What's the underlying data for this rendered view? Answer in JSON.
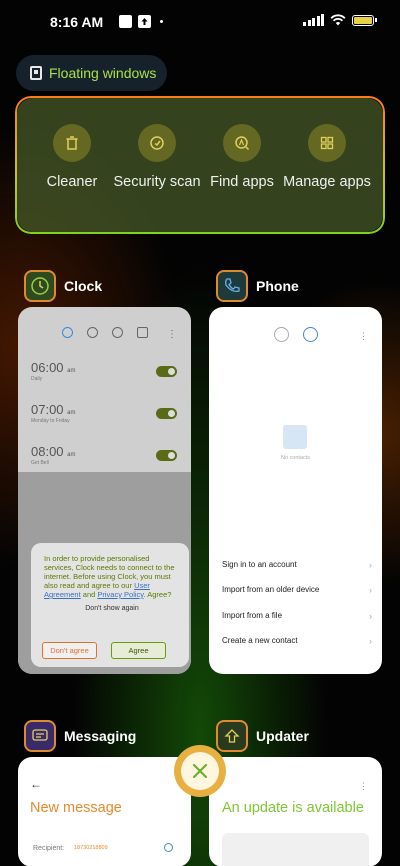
{
  "status_bar": {
    "time": "8:16 AM"
  },
  "floating_windows": {
    "label": "Floating windows"
  },
  "tools": [
    {
      "label": "Cleaner",
      "icon": "trash-icon"
    },
    {
      "label": "Security scan",
      "icon": "shield-check-icon"
    },
    {
      "label": "Find apps",
      "icon": "search-app-icon"
    },
    {
      "label": "Manage apps",
      "icon": "grid-icon"
    }
  ],
  "apps": {
    "clock": {
      "title": "Clock",
      "alarms": [
        {
          "time": "06:00",
          "ampm": "am",
          "sub": "Daily"
        },
        {
          "time": "07:00",
          "ampm": "am",
          "sub": "Monday to Friday"
        },
        {
          "time": "08:00",
          "ampm": "am",
          "sub": "Get Bell"
        }
      ],
      "dialog": {
        "text_1": "In order to provide personalised services, Clock needs to connect to the internet. Before using Clock, you must also read and agree to our ",
        "link_1": "User Agreement",
        "text_2": " and ",
        "link_2": "Privacy Policy",
        "text_3": ". Agree?",
        "secondary": "Don't show again",
        "disagree": "Don't agree",
        "agree": "Agree"
      }
    },
    "phone": {
      "title": "Phone",
      "empty_text": "No contacts",
      "options": [
        "Sign in to an account",
        "Import from an older device",
        "Import from a file",
        "Create a new contact"
      ]
    },
    "messaging": {
      "title": "Messaging",
      "screen_title": "New message",
      "recipient_label": "Recipient:",
      "recipient_number": "18730218809"
    },
    "updater": {
      "title": "Updater",
      "screen_title": "An update is available"
    }
  },
  "colors": {
    "accent_green": "#a8e24a",
    "accent_orange": "#e88a2a",
    "close_button": "#e8b040"
  }
}
